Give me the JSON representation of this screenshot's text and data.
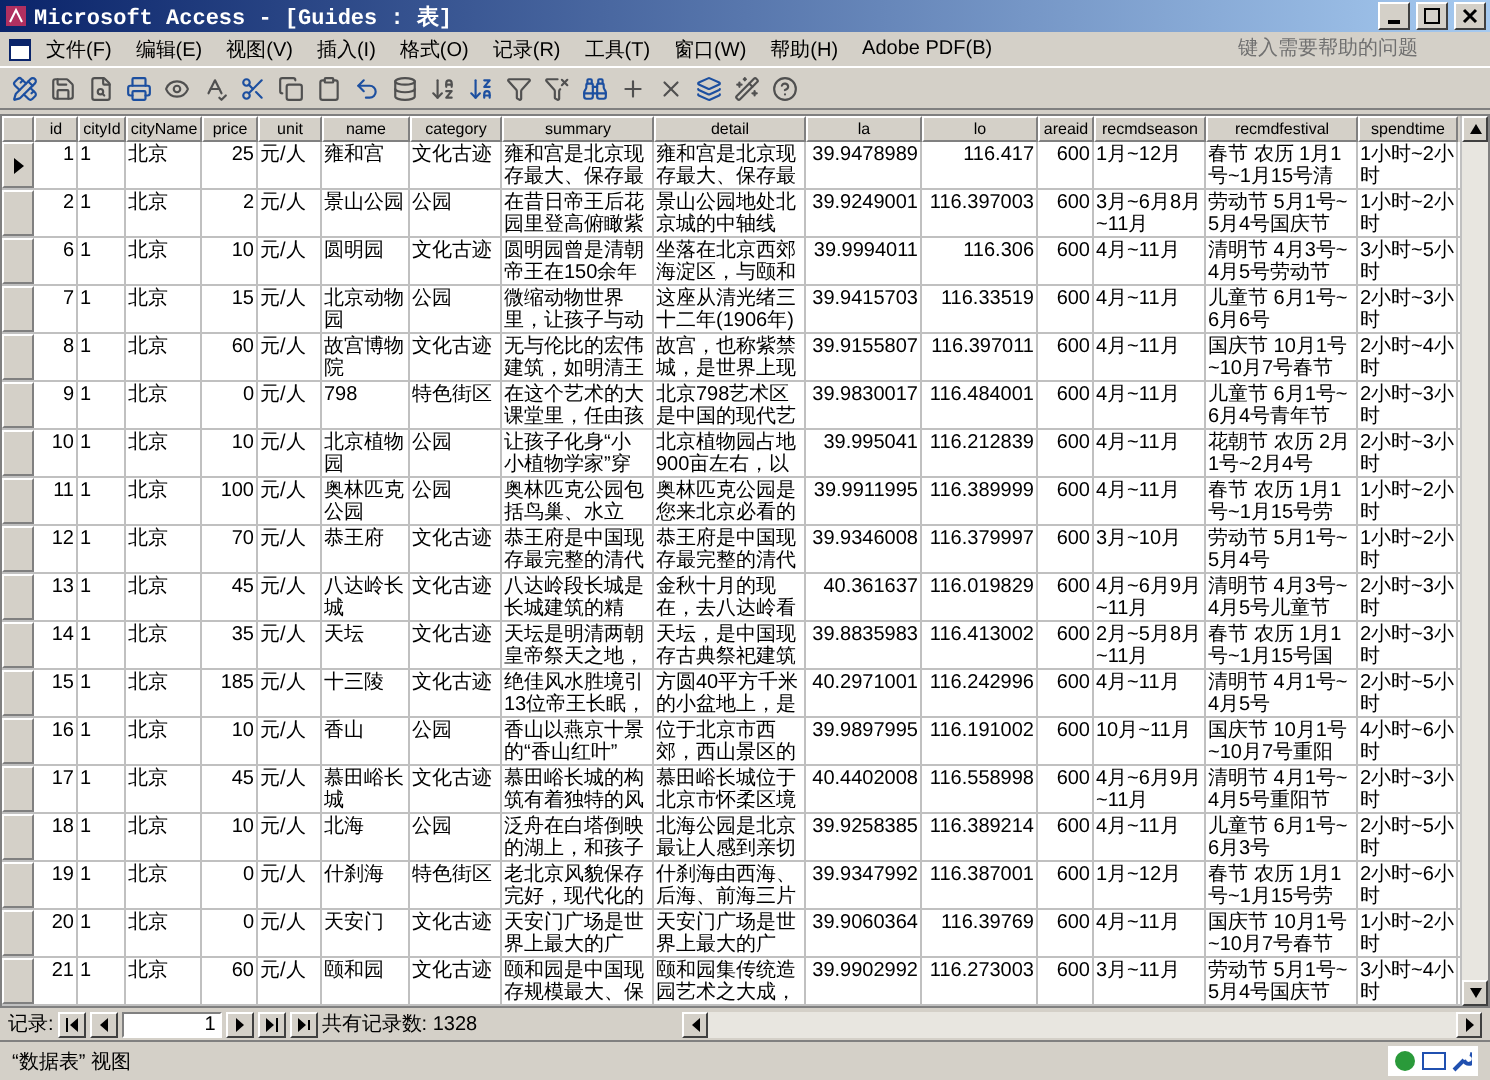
{
  "window": {
    "title": "Microsoft Access - [Guides : 表]"
  },
  "menu": [
    "文件(F)",
    "编辑(E)",
    "视图(V)",
    "插入(I)",
    "格式(O)",
    "记录(R)",
    "工具(T)",
    "窗口(W)",
    "帮助(H)",
    "Adobe PDF(B)"
  ],
  "help_box": {
    "placeholder": "键入需要帮助的问题"
  },
  "table": {
    "columns": [
      "id",
      "cityId",
      "cityName",
      "price",
      "unit",
      "name",
      "category",
      "summary",
      "detail",
      "la",
      "lo",
      "areaid",
      "recmdseason",
      "recmdfestival",
      "spendtime"
    ],
    "rows": [
      {
        "selected": true,
        "cells": [
          "1",
          "1",
          "北京",
          "25",
          "元/人",
          "雍和宫",
          "文化古迹",
          "雍和宫是北京现存最大、保存最",
          "雍和宫是北京现存最大、保存最",
          "39.9478989",
          "116.417",
          "600",
          "1月~12月",
          "春节 农历 1月1号~1月15号清",
          "1小时~2小时"
        ]
      },
      {
        "selected": false,
        "cells": [
          "2",
          "1",
          "北京",
          "2",
          "元/人",
          "景山公园",
          "公园",
          "在昔日帝王后花园里登高俯瞰紫",
          "景山公园地处北京城的中轴线",
          "39.9249001",
          "116.397003",
          "600",
          "3月~6月8月~11月",
          "劳动节 5月1号~5月4号国庆节",
          "1小时~2小时"
        ]
      },
      {
        "selected": false,
        "cells": [
          "6",
          "1",
          "北京",
          "10",
          "元/人",
          "圆明园",
          "文化古迹",
          "圆明园曾是清朝帝王在150余年",
          "坐落在北京西郊海淀区，与颐和",
          "39.9994011",
          "116.306",
          "600",
          "4月~11月",
          "清明节 4月3号~4月5号劳动节",
          "3小时~5小时"
        ]
      },
      {
        "selected": false,
        "cells": [
          "7",
          "1",
          "北京",
          "15",
          "元/人",
          "北京动物园",
          "公园",
          "微缩动物世界里，让孩子与动",
          "这座从清光绪三十二年(1906年)",
          "39.9415703",
          "116.33519",
          "600",
          "4月~11月",
          "儿童节 6月1号~6月6号",
          "2小时~3小时"
        ]
      },
      {
        "selected": false,
        "cells": [
          "8",
          "1",
          "北京",
          "60",
          "元/人",
          "故宫博物院",
          "文化古迹",
          "无与伦比的宏伟建筑，如明清王",
          "故宫，也称紫禁城，是世界上现",
          "39.9155807",
          "116.397011",
          "600",
          "4月~11月",
          "国庆节 10月1号~10月7号春节",
          "2小时~4小时"
        ]
      },
      {
        "selected": false,
        "cells": [
          "9",
          "1",
          "北京",
          "0",
          "元/人",
          "798",
          "特色街区",
          "在这个艺术的大课堂里，任由孩",
          "北京798艺术区是中国的现代艺",
          "39.9830017",
          "116.484001",
          "600",
          "4月~11月",
          "儿童节 6月1号~6月4号青年节",
          "2小时~3小时"
        ]
      },
      {
        "selected": false,
        "cells": [
          "10",
          "1",
          "北京",
          "10",
          "元/人",
          "北京植物园",
          "公园",
          "让孩子化身“小小植物学家”穿",
          "北京植物园占地900亩左右，以",
          "39.995041",
          "116.212839",
          "600",
          "4月~11月",
          "花朝节 农历 2月1号~2月4号",
          "2小时~3小时"
        ]
      },
      {
        "selected": false,
        "cells": [
          "11",
          "1",
          "北京",
          "100",
          "元/人",
          "奥林匹克公园",
          "公园",
          "奥林匹克公园包括鸟巢、水立",
          "奥林匹克公园是您来北京必看的",
          "39.9911995",
          "116.389999",
          "600",
          "4月~11月",
          "春节 农历 1月1号~1月15号劳",
          "1小时~2小时"
        ]
      },
      {
        "selected": false,
        "cells": [
          "12",
          "1",
          "北京",
          "70",
          "元/人",
          "恭王府",
          "文化古迹",
          "恭王府是中国现存最完整的清代",
          "恭王府是中国现存最完整的清代",
          "39.9346008",
          "116.379997",
          "600",
          "3月~10月",
          "劳动节 5月1号~5月4号",
          "1小时~2小时"
        ]
      },
      {
        "selected": false,
        "cells": [
          "13",
          "1",
          "北京",
          "45",
          "元/人",
          "八达岭长城",
          "文化古迹",
          "八达岭段长城是长城建筑的精",
          "金秋十月的现在，去八达岭看",
          "40.361637",
          "116.019829",
          "600",
          "4月~6月9月~11月",
          "清明节 4月3号~4月5号儿童节",
          "2小时~3小时"
        ]
      },
      {
        "selected": false,
        "cells": [
          "14",
          "1",
          "北京",
          "35",
          "元/人",
          "天坛",
          "文化古迹",
          "天坛是明清两朝皇帝祭天之地，",
          "天坛，是中国现存古典祭祀建筑",
          "39.8835983",
          "116.413002",
          "600",
          "2月~5月8月~11月",
          "春节 农历 1月1号~1月15号国",
          "2小时~3小时"
        ]
      },
      {
        "selected": false,
        "cells": [
          "15",
          "1",
          "北京",
          "185",
          "元/人",
          "十三陵",
          "文化古迹",
          "绝佳风水胜境引13位帝王长眠，",
          "方圆40平方千米的小盆地上，是",
          "40.2971001",
          "116.242996",
          "600",
          "4月~11月",
          "清明节 4月1号~4月5号",
          "2小时~5小时"
        ]
      },
      {
        "selected": false,
        "cells": [
          "16",
          "1",
          "北京",
          "10",
          "元/人",
          "香山",
          "公园",
          "香山以燕京十景的“香山红叶”",
          "位于北京市西郊，西山景区的",
          "39.9897995",
          "116.191002",
          "600",
          "10月~11月",
          "国庆节 10月1号~10月7号重阳",
          "4小时~6小时"
        ]
      },
      {
        "selected": false,
        "cells": [
          "17",
          "1",
          "北京",
          "45",
          "元/人",
          "慕田峪长城",
          "文化古迹",
          "慕田峪长城的构筑有着独特的风",
          "慕田峪长城位于北京市怀柔区境",
          "40.4402008",
          "116.558998",
          "600",
          "4月~6月9月~11月",
          "清明节 4月1号~4月5号重阳节",
          "2小时~3小时"
        ]
      },
      {
        "selected": false,
        "cells": [
          "18",
          "1",
          "北京",
          "10",
          "元/人",
          "北海",
          "公园",
          "泛舟在白塔倒映的湖上，和孩子",
          "北海公园是北京最让人感到亲切",
          "39.9258385",
          "116.389214",
          "600",
          "4月~11月",
          "儿童节 6月1号~6月3号",
          "2小时~5小时"
        ]
      },
      {
        "selected": false,
        "cells": [
          "19",
          "1",
          "北京",
          "0",
          "元/人",
          "什刹海",
          "特色街区",
          "老北京风貌保存完好，现代化的",
          "什刹海由西海、后海、前海三片",
          "39.9347992",
          "116.387001",
          "600",
          "1月~12月",
          "春节 农历 1月1号~1月15号劳",
          "2小时~6小时"
        ]
      },
      {
        "selected": false,
        "cells": [
          "20",
          "1",
          "北京",
          "0",
          "元/人",
          "天安门",
          "文化古迹",
          "天安门广场是世界上最大的广",
          "天安门广场是世界上最大的广",
          "39.9060364",
          "116.39769",
          "600",
          "4月~11月",
          "国庆节 10月1号~10月7号春节",
          "1小时~2小时"
        ]
      },
      {
        "selected": false,
        "cells": [
          "21",
          "1",
          "北京",
          "60",
          "元/人",
          "颐和园",
          "文化古迹",
          "颐和园是中国现存规模最大、保",
          "颐和园集传统造园艺术之大成，",
          "39.9902992",
          "116.273003",
          "600",
          "3月~11月",
          "劳动节 5月1号~5月4号国庆节",
          "3小时~4小时"
        ]
      }
    ]
  },
  "navigator": {
    "label": "记录:",
    "record": "1",
    "total": "共有记录数: 1328"
  },
  "status_bar": {
    "text": "“数据表” 视图"
  }
}
